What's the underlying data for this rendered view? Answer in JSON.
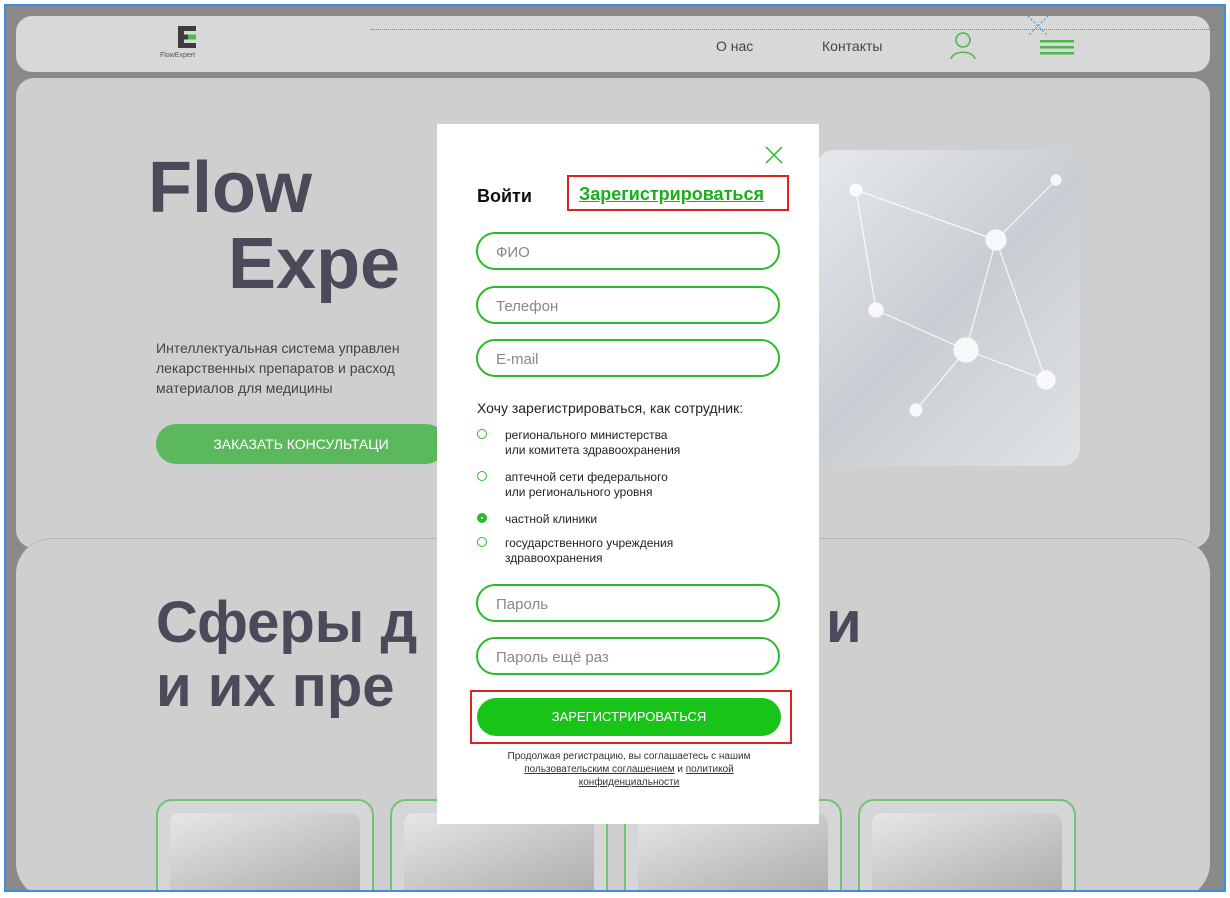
{
  "header": {
    "logo_text": "FlowExpert",
    "nav": [
      "О нас",
      "Контакты"
    ],
    "user_icon": "user-icon",
    "menu_icon": "hamburger-menu-icon"
  },
  "hero": {
    "title_line1": "Flow",
    "title_line2": "Expe",
    "description": "Интеллектуальная система управлен лекарственных препаратов и расход материалов для медицины",
    "cta_label": "ЗАКАЗАТЬ КОНСУЛЬТАЦИ"
  },
  "section": {
    "title_line1": "Сферы д",
    "title_line1_tail": "и",
    "title_line2": "и их пре"
  },
  "modal": {
    "close_icon": "close-icon",
    "tab_login": "Войти",
    "tab_register": "Зарегистрироваться",
    "fields": {
      "fio_placeholder": "ФИО",
      "phone_placeholder": "Телефон",
      "email_placeholder": "E-mail",
      "password_placeholder": "Пароль",
      "password_repeat_placeholder": "Пароль ещё раз"
    },
    "roles_title": "Хочу зарегистрироваться, как сотрудник:",
    "roles": [
      {
        "label": "регионального министерства\nили комитета здравоохранения",
        "selected": false
      },
      {
        "label": "аптечной сети федерального\nили регионального уровня",
        "selected": false
      },
      {
        "label": "частной клиники",
        "selected": true
      },
      {
        "label": "государственного учреждения\nздравоохранения",
        "selected": false
      }
    ],
    "submit_label": "ЗАРЕГИСТРИРОВАТЬСЯ",
    "consent": {
      "prefix": "Продолжая регистрацию, вы соглашаетесь с нашим",
      "link1": "пользовательским соглашением",
      "and": "и",
      "link2": "политикой конфиденциальности"
    }
  },
  "colors": {
    "accent": "#17c417",
    "highlight_box": "#dd2222",
    "overlay": "#8a8a8a"
  }
}
